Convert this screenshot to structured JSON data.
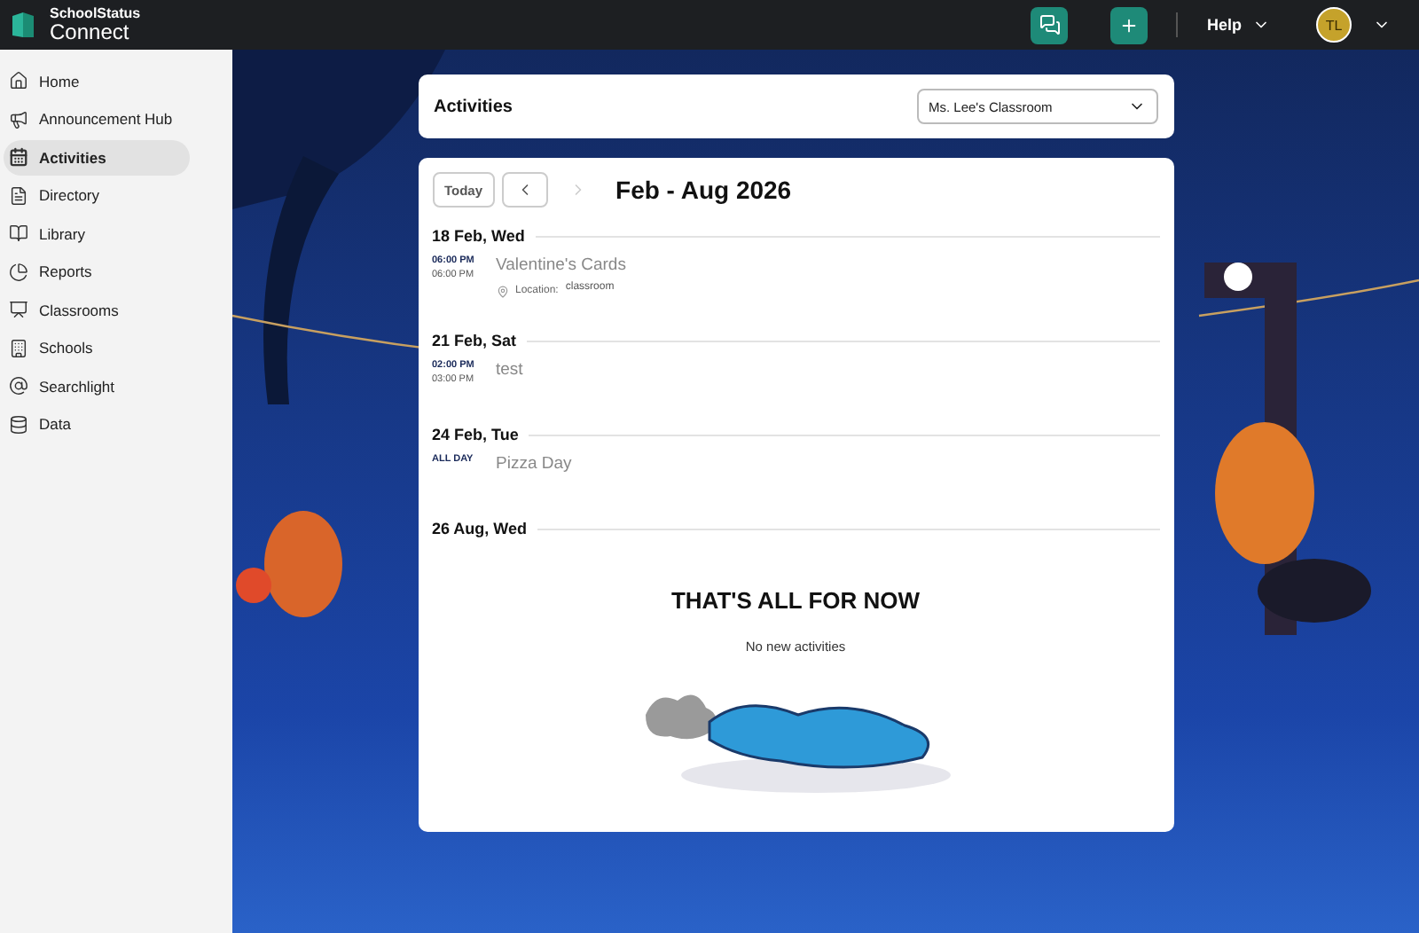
{
  "topbar": {
    "brand_top": "SchoolStatus",
    "brand_bottom": "Connect",
    "help": "Help",
    "avatar": "TL"
  },
  "sidebar": {
    "items": [
      {
        "label": "Home",
        "selected": false
      },
      {
        "label": "Announcement Hub",
        "selected": false
      },
      {
        "label": "Activities",
        "selected": true
      },
      {
        "label": "Directory",
        "selected": false
      },
      {
        "label": "Library",
        "selected": false
      },
      {
        "label": "Reports",
        "selected": false
      },
      {
        "label": "Classrooms",
        "selected": false
      },
      {
        "label": "Schools",
        "selected": false
      },
      {
        "label": "Searchlight",
        "selected": false
      },
      {
        "label": "Data",
        "selected": false
      }
    ]
  },
  "header": {
    "title": "Activities",
    "classroom_select": "Ms. Lee's Classroom"
  },
  "calendar": {
    "today": "Today",
    "prev_disabled": false,
    "next_disabled": true,
    "range": "Feb - Aug 2026",
    "days": [
      {
        "date": "18 Feb, Wed",
        "events": [
          {
            "times": [
              "06:00 PM",
              "06:00 PM"
            ],
            "title": "Valentine's Cards",
            "location_label": "Location:",
            "location": "classroom"
          }
        ]
      },
      {
        "date": "21 Feb, Sat",
        "events": [
          {
            "times": [
              "02:00 PM",
              "03:00 PM"
            ],
            "title": "test"
          }
        ]
      },
      {
        "date": "24 Feb, Tue",
        "events": [
          {
            "times": [
              "ALL DAY"
            ],
            "title": "Pizza Day"
          }
        ]
      },
      {
        "date": "26 Aug, Wed"
      }
    ],
    "empty_title": "THAT'S ALL FOR NOW",
    "empty_text": "No new activities"
  }
}
